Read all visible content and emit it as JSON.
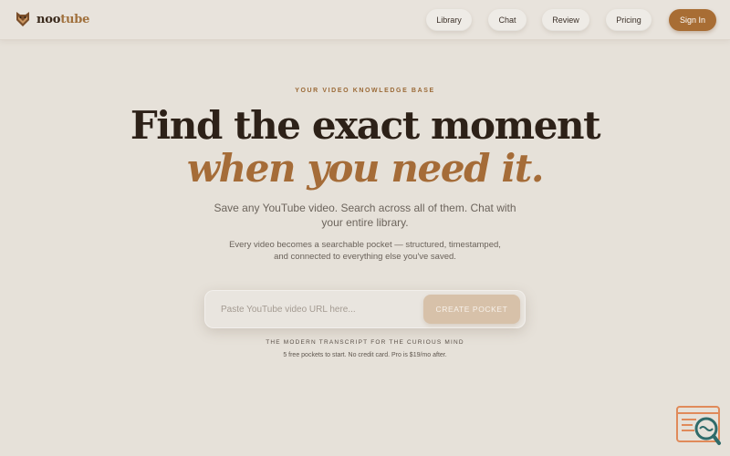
{
  "brand": {
    "name_primary": "noo",
    "name_accent": "tube",
    "accent_color": "#a86d34"
  },
  "nav": {
    "items": [
      "Library",
      "Chat",
      "Review",
      "Pricing"
    ],
    "sign_in": "Sign In"
  },
  "hero": {
    "eyebrow": "YOUR VIDEO KNOWLEDGE BASE",
    "title_line1": "Find the exact moment",
    "title_line2": "when you need it.",
    "subtitle": "Save any YouTube video. Search across all of them. Chat with your entire library.",
    "description": "Every video becomes a searchable pocket — structured, timestamped, and connected to everything else you've saved."
  },
  "form": {
    "url_placeholder": "Paste YouTube video URL here...",
    "url_value": "",
    "create_label": "CREATE POCKET"
  },
  "footer": {
    "tagline": "THE MODERN TRANSCRIPT FOR THE CURIOUS MIND",
    "fineprint": "5 free pockets to start. No credit card. Pro is $19/mo after."
  },
  "icons": {
    "logo": "fox-logo-icon",
    "widget": "search-transcript-icon"
  }
}
